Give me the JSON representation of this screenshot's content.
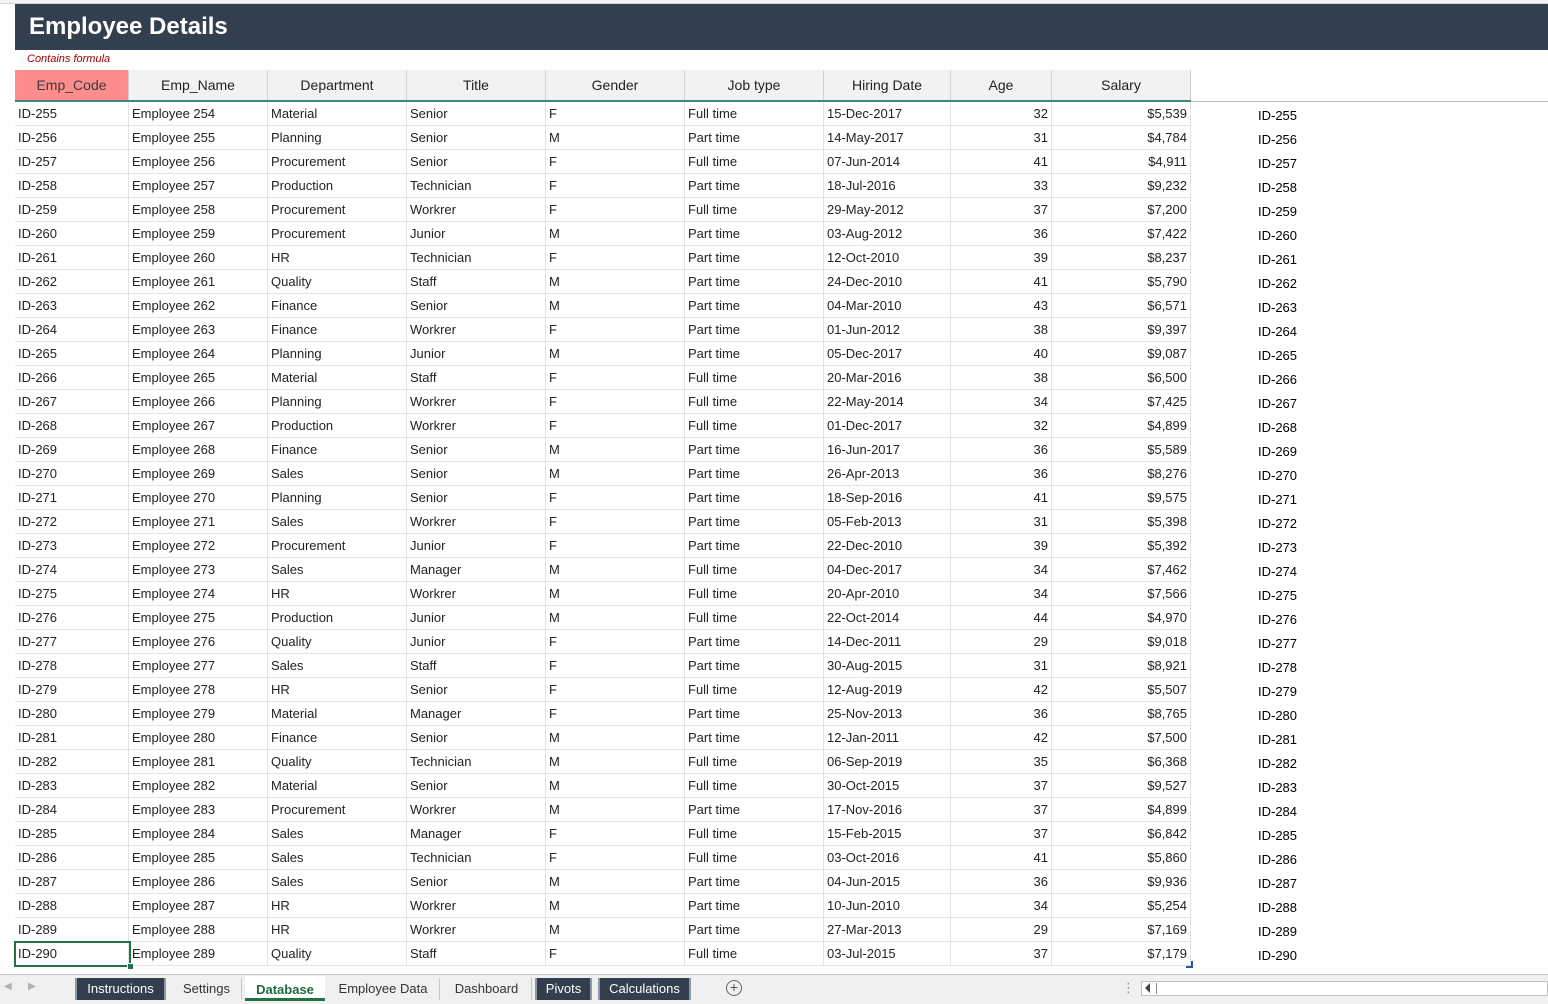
{
  "title": "Employee Details",
  "note": "Contains formula",
  "columns": [
    "Emp_Code",
    "Emp_Name",
    "Department",
    "Title",
    "Gender",
    "Job type",
    "Hiring Date",
    "Age",
    "Salary"
  ],
  "rows": [
    [
      "ID-255",
      "Employee 254",
      "Material",
      "Senior",
      "F",
      "Full time",
      "15-Dec-2017",
      "32",
      "$5,539"
    ],
    [
      "ID-256",
      "Employee 255",
      "Planning",
      "Senior",
      "M",
      "Part time",
      "14-May-2017",
      "31",
      "$4,784"
    ],
    [
      "ID-257",
      "Employee 256",
      "Procurement",
      "Senior",
      "F",
      "Full time",
      "07-Jun-2014",
      "41",
      "$4,911"
    ],
    [
      "ID-258",
      "Employee 257",
      "Production",
      "Technician",
      "F",
      "Part time",
      "18-Jul-2016",
      "33",
      "$9,232"
    ],
    [
      "ID-259",
      "Employee 258",
      "Procurement",
      "Workrer",
      "F",
      "Full time",
      "29-May-2012",
      "37",
      "$7,200"
    ],
    [
      "ID-260",
      "Employee 259",
      "Procurement",
      "Junior",
      "M",
      "Part time",
      "03-Aug-2012",
      "36",
      "$7,422"
    ],
    [
      "ID-261",
      "Employee 260",
      "HR",
      "Technician",
      "F",
      "Part time",
      "12-Oct-2010",
      "39",
      "$8,237"
    ],
    [
      "ID-262",
      "Employee 261",
      "Quality",
      "Staff",
      "M",
      "Part time",
      "24-Dec-2010",
      "41",
      "$5,790"
    ],
    [
      "ID-263",
      "Employee 262",
      "Finance",
      "Senior",
      "M",
      "Part time",
      "04-Mar-2010",
      "43",
      "$6,571"
    ],
    [
      "ID-264",
      "Employee 263",
      "Finance",
      "Workrer",
      "F",
      "Part time",
      "01-Jun-2012",
      "38",
      "$9,397"
    ],
    [
      "ID-265",
      "Employee 264",
      "Planning",
      "Junior",
      "M",
      "Part time",
      "05-Dec-2017",
      "40",
      "$9,087"
    ],
    [
      "ID-266",
      "Employee 265",
      "Material",
      "Staff",
      "F",
      "Full time",
      "20-Mar-2016",
      "38",
      "$6,500"
    ],
    [
      "ID-267",
      "Employee 266",
      "Planning",
      "Workrer",
      "F",
      "Full time",
      "22-May-2014",
      "34",
      "$7,425"
    ],
    [
      "ID-268",
      "Employee 267",
      "Production",
      "Workrer",
      "F",
      "Full time",
      "01-Dec-2017",
      "32",
      "$4,899"
    ],
    [
      "ID-269",
      "Employee 268",
      "Finance",
      "Senior",
      "M",
      "Part time",
      "16-Jun-2017",
      "36",
      "$5,589"
    ],
    [
      "ID-270",
      "Employee 269",
      "Sales",
      "Senior",
      "M",
      "Part time",
      "26-Apr-2013",
      "36",
      "$8,276"
    ],
    [
      "ID-271",
      "Employee 270",
      "Planning",
      "Senior",
      "F",
      "Part time",
      "18-Sep-2016",
      "41",
      "$9,575"
    ],
    [
      "ID-272",
      "Employee 271",
      "Sales",
      "Workrer",
      "F",
      "Part time",
      "05-Feb-2013",
      "31",
      "$5,398"
    ],
    [
      "ID-273",
      "Employee 272",
      "Procurement",
      "Junior",
      "F",
      "Part time",
      "22-Dec-2010",
      "39",
      "$5,392"
    ],
    [
      "ID-274",
      "Employee 273",
      "Sales",
      "Manager",
      "M",
      "Full time",
      "04-Dec-2017",
      "34",
      "$7,462"
    ],
    [
      "ID-275",
      "Employee 274",
      "HR",
      "Workrer",
      "M",
      "Full time",
      "20-Apr-2010",
      "34",
      "$7,566"
    ],
    [
      "ID-276",
      "Employee 275",
      "Production",
      "Junior",
      "M",
      "Full time",
      "22-Oct-2014",
      "44",
      "$4,970"
    ],
    [
      "ID-277",
      "Employee 276",
      "Quality",
      "Junior",
      "F",
      "Part time",
      "14-Dec-2011",
      "29",
      "$9,018"
    ],
    [
      "ID-278",
      "Employee 277",
      "Sales",
      "Staff",
      "F",
      "Part time",
      "30-Aug-2015",
      "31",
      "$8,921"
    ],
    [
      "ID-279",
      "Employee 278",
      "HR",
      "Senior",
      "F",
      "Full time",
      "12-Aug-2019",
      "42",
      "$5,507"
    ],
    [
      "ID-280",
      "Employee 279",
      "Material",
      "Manager",
      "F",
      "Part time",
      "25-Nov-2013",
      "36",
      "$8,765"
    ],
    [
      "ID-281",
      "Employee 280",
      "Finance",
      "Senior",
      "M",
      "Part time",
      "12-Jan-2011",
      "42",
      "$7,500"
    ],
    [
      "ID-282",
      "Employee 281",
      "Quality",
      "Technician",
      "M",
      "Full time",
      "06-Sep-2019",
      "35",
      "$6,368"
    ],
    [
      "ID-283",
      "Employee 282",
      "Material",
      "Senior",
      "M",
      "Full time",
      "30-Oct-2015",
      "37",
      "$9,527"
    ],
    [
      "ID-284",
      "Employee 283",
      "Procurement",
      "Workrer",
      "M",
      "Part time",
      "17-Nov-2016",
      "37",
      "$4,899"
    ],
    [
      "ID-285",
      "Employee 284",
      "Sales",
      "Manager",
      "F",
      "Full time",
      "15-Feb-2015",
      "37",
      "$6,842"
    ],
    [
      "ID-286",
      "Employee 285",
      "Sales",
      "Technician",
      "F",
      "Full time",
      "03-Oct-2016",
      "41",
      "$5,860"
    ],
    [
      "ID-287",
      "Employee 286",
      "Sales",
      "Senior",
      "M",
      "Part time",
      "04-Jun-2015",
      "36",
      "$9,936"
    ],
    [
      "ID-288",
      "Employee 287",
      "HR",
      "Workrer",
      "M",
      "Part time",
      "10-Jun-2010",
      "34",
      "$5,254"
    ],
    [
      "ID-289",
      "Employee 288",
      "HR",
      "Workrer",
      "M",
      "Part time",
      "27-Mar-2013",
      "29",
      "$7,169"
    ],
    [
      "ID-290",
      "Employee 289",
      "Quality",
      "Staff",
      "F",
      "Full time",
      "03-Jul-2015",
      "37",
      "$7,179"
    ]
  ],
  "side_ids": [
    "ID-255",
    "ID-256",
    "ID-257",
    "ID-258",
    "ID-259",
    "ID-260",
    "ID-261",
    "ID-262",
    "ID-263",
    "ID-264",
    "ID-265",
    "ID-266",
    "ID-267",
    "ID-268",
    "ID-269",
    "ID-270",
    "ID-271",
    "ID-272",
    "ID-273",
    "ID-274",
    "ID-275",
    "ID-276",
    "ID-277",
    "ID-278",
    "ID-279",
    "ID-280",
    "ID-281",
    "ID-282",
    "ID-283",
    "ID-284",
    "ID-285",
    "ID-286",
    "ID-287",
    "ID-288",
    "ID-289",
    "ID-290"
  ],
  "tabs": [
    {
      "label": "Instructions",
      "style": "dark"
    },
    {
      "label": "Settings",
      "style": "plain"
    },
    {
      "label": "Database",
      "style": "active"
    },
    {
      "label": "Employee Data",
      "style": "plain"
    },
    {
      "label": "Dashboard",
      "style": "plain"
    },
    {
      "label": "Pivots",
      "style": "dark"
    },
    {
      "label": "Calculations",
      "style": "dark"
    }
  ],
  "icons": {
    "add_sheet": "plus-circle-icon",
    "nav_prev": "chevron-left-icon",
    "nav_next": "chevron-right-icon",
    "more": "vertical-dots-icon",
    "scroll_left": "triangle-left-icon"
  },
  "colors": {
    "banner": "#333f4f",
    "key_header": "#ff8d8d",
    "selection": "#217346",
    "note": "#a00000"
  }
}
